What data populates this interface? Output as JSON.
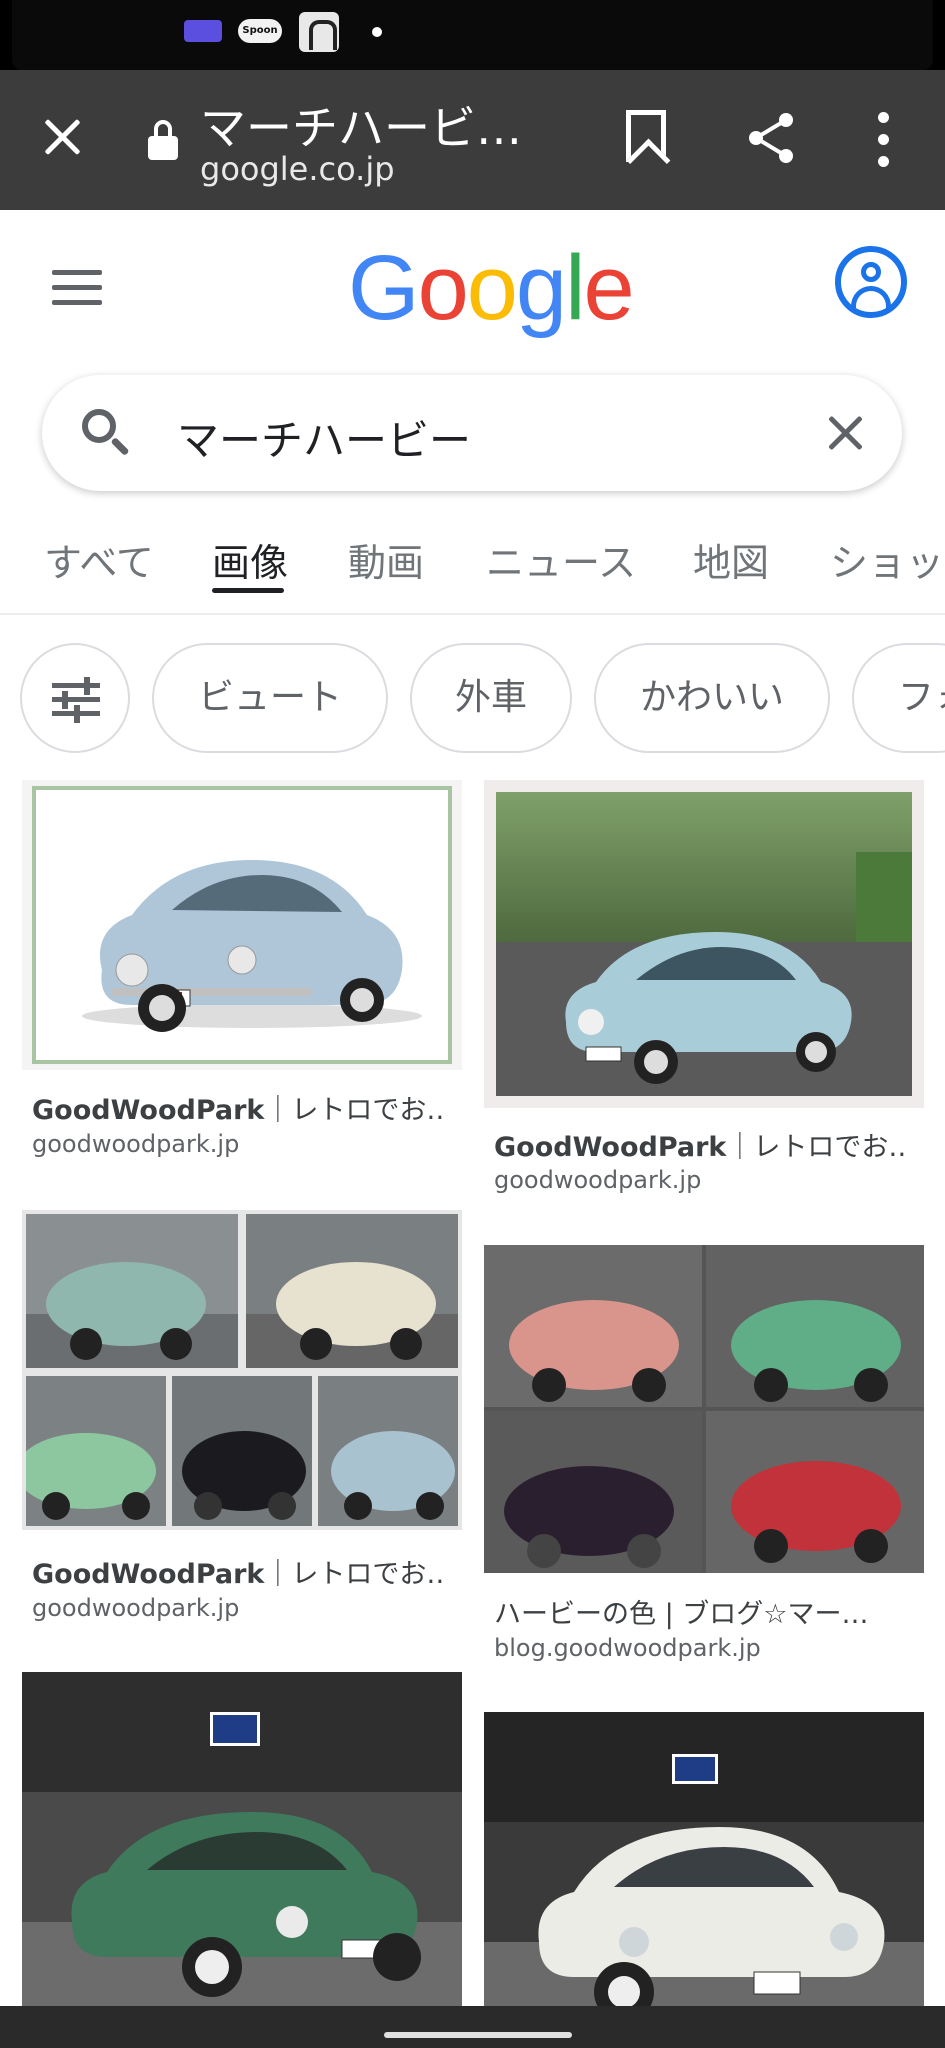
{
  "status_bar": {
    "icons": [
      "game-icon",
      "spoon-icon",
      "app-icon",
      "dot-icon"
    ],
    "spoon_label": "Spoon"
  },
  "browser": {
    "title": "マーチハービ…",
    "url": "google.co.jp",
    "icons": [
      "close-icon",
      "lock-icon",
      "bookmark-icon",
      "share-icon",
      "more-vert-icon"
    ]
  },
  "google": {
    "logo": [
      "G",
      "o",
      "o",
      "g",
      "l",
      "e"
    ],
    "colors": {
      "blue": "#4285f4",
      "red": "#ea4335",
      "yellow": "#fbbc05",
      "green": "#34a853"
    }
  },
  "search": {
    "query": "マーチハービー"
  },
  "tabs": [
    {
      "label": "すべて",
      "active": false
    },
    {
      "label": "画像",
      "active": true
    },
    {
      "label": "動画",
      "active": false
    },
    {
      "label": "ニュース",
      "active": false
    },
    {
      "label": "地図",
      "active": false
    },
    {
      "label": "ショッ",
      "active": false
    }
  ],
  "chips": [
    "ビュート",
    "外車",
    "かわいい",
    "フォ"
  ],
  "results": [
    {
      "title_bold": "GoodWoodPark",
      "title_rest": "｜レトロでお…",
      "domain": "goodwoodpark.jp"
    },
    {
      "title_bold": "GoodWoodPark",
      "title_rest": "｜レトロでお…",
      "domain": "goodwoodpark.jp"
    },
    {
      "title_bold": "GoodWoodPark",
      "title_rest": "｜レトロでお…",
      "domain": "goodwoodpark.jp"
    },
    {
      "title_bold": "",
      "title_rest": "ハービーの色 | ブログ☆マー…",
      "domain": "blog.goodwoodpark.jp"
    }
  ]
}
